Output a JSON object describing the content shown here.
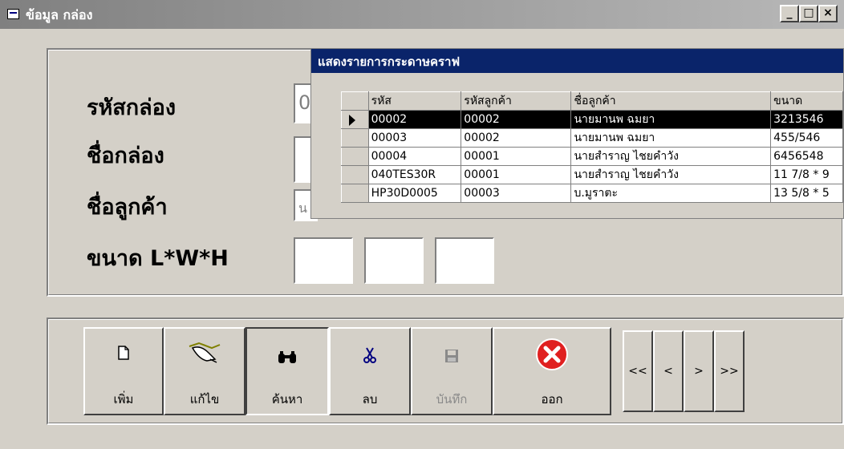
{
  "window": {
    "title": "ข้อมูล กล่อง",
    "minimize": "_",
    "maximize": "□",
    "close": "×"
  },
  "form": {
    "labels": {
      "box_code": "รหัสกล่อง",
      "box_name": "ชื่อกล่อง",
      "customer_name": "ชื่อลูกค้า",
      "size": "ขนาด L*W*H"
    },
    "values": {
      "box_code": "0",
      "box_name": "",
      "customer_name": "น",
      "length": "",
      "width": "",
      "height": ""
    }
  },
  "popup": {
    "title": "แสดงรายการกระดาษคราฟ",
    "columns": [
      "รหัส",
      "รหัสลูกค้า",
      "ชื่อลูกค้า",
      "ขนาด"
    ],
    "rows": [
      [
        "00002",
        "00002",
        "นายมานพ ฉมยา",
        "3213546"
      ],
      [
        "00003",
        "00002",
        "นายมานพ ฉมยา",
        "455/546"
      ],
      [
        "00004",
        "00001",
        "นายสำราญ ไชยคำวัง",
        "6456548"
      ],
      [
        "040TES30R",
        "00001",
        "นายสำราญ ไชยคำวัง",
        "11 7/8 * 9"
      ],
      [
        "HP30D0005",
        "00003",
        "บ.มูราตะ",
        "13 5/8 * 5"
      ]
    ],
    "selected_row": 0
  },
  "toolbar": {
    "add": "เพิ่ม",
    "edit": "แก้ไข",
    "search": "ค้นหา",
    "delete": "ลบ",
    "save": "บันทึก",
    "exit": "ออก",
    "first": "<<",
    "prev": "<",
    "next": ">",
    "last": ">>"
  },
  "icons": {
    "add": "new-document-icon",
    "edit": "hand-pen-icon",
    "search": "binoculars-icon",
    "delete": "scissors-icon",
    "save": "floppy-disk-icon",
    "exit": "red-x-circle-icon"
  },
  "colors": {
    "titlebar_inactive": "#808080",
    "popup_title": "#0a246a",
    "face": "#d4d0c8",
    "exit_red": "#e02020"
  }
}
